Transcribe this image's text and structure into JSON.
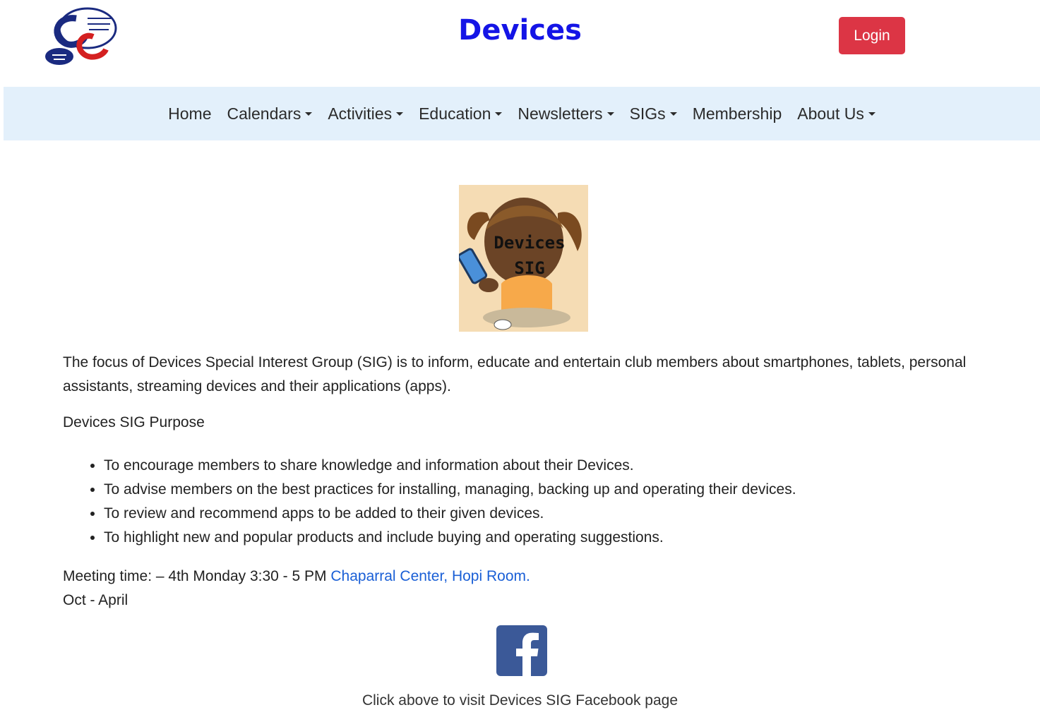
{
  "header": {
    "title": "Devices",
    "login_label": "Login",
    "logo_icon": "club-logo-icon"
  },
  "nav": {
    "items": [
      {
        "label": "Home",
        "dropdown": false
      },
      {
        "label": "Calendars",
        "dropdown": true
      },
      {
        "label": "Activities",
        "dropdown": true
      },
      {
        "label": "Education",
        "dropdown": true
      },
      {
        "label": "Newsletters",
        "dropdown": true
      },
      {
        "label": "SIGs",
        "dropdown": true
      },
      {
        "label": "Membership",
        "dropdown": false
      },
      {
        "label": "About Us",
        "dropdown": true
      }
    ]
  },
  "main": {
    "image_text_line1": "Devices",
    "image_text_line2": "SIG",
    "intro": "The focus of Devices Special Interest Group (SIG) is to inform, educate and entertain club members about smartphones, tablets, personal assistants, streaming devices and their applications (apps).",
    "purpose_heading": "Devices SIG Purpose",
    "purpose_items": [
      "To encourage members to share knowledge and information about their Devices.",
      "To advise members on the best practices for installing, managing, backing up and operating their devices.",
      "To review and recommend apps to be added to their given devices.",
      "To highlight new and popular products and include buying and operating suggestions."
    ],
    "meeting_prefix": "Meeting time: – 4th Monday 3:30 - 5 PM ",
    "meeting_location": "Chaparral Center, Hopi Room.",
    "meeting_season": "Oct - April",
    "facebook_caption": "Click above to visit Devices SIG Facebook page"
  },
  "colors": {
    "title": "#1414e6",
    "login_button": "#dc3545",
    "navbar_bg": "#e3f0fb",
    "link": "#1a5fd6",
    "facebook": "#3b5998"
  }
}
